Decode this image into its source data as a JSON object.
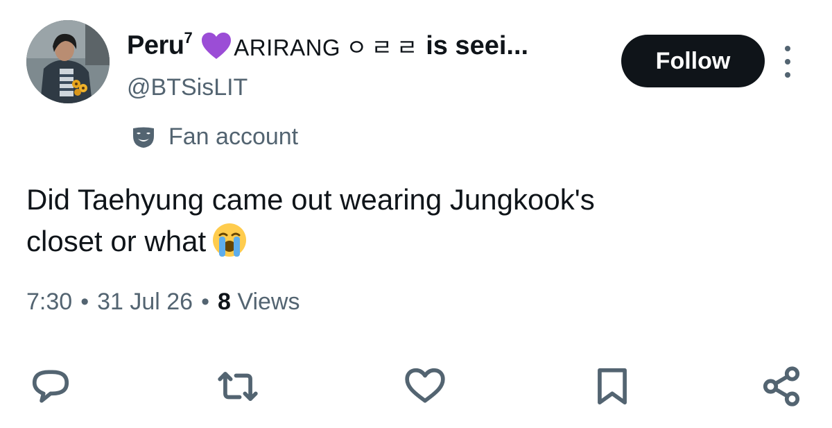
{
  "tweet": {
    "author": {
      "display_name": "Peru",
      "superscript": "7",
      "tag": "ARIRANG",
      "hangul": "ㅇㄹㄹ",
      "name_rest": "is seei...",
      "handle": "@BTSisLIT",
      "label": "Fan account"
    },
    "follow_label": "Follow",
    "text_line1": "Did Taehyung came out wearing Jungkook's",
    "text_line2": "closet or what",
    "time": "7:30",
    "date": "31 Jul 26",
    "views_count": "8",
    "views_label": "Views",
    "separator": "•"
  },
  "icons": {
    "heart_emoji": "purple-heart-icon",
    "crying_emoji": "loudly-crying-face-icon",
    "more": "more-vertical-icon",
    "fan_badge": "mask-icon",
    "reply": "reply-icon",
    "retweet": "retweet-icon",
    "like": "like-icon",
    "bookmark": "bookmark-icon",
    "share": "share-icon"
  },
  "colors": {
    "text": "#0f1419",
    "secondary": "#536471",
    "button_bg": "#0f1419",
    "heart": "#9b4dd6",
    "emoji": "#ffcc4d",
    "tears": "#5dadec"
  }
}
